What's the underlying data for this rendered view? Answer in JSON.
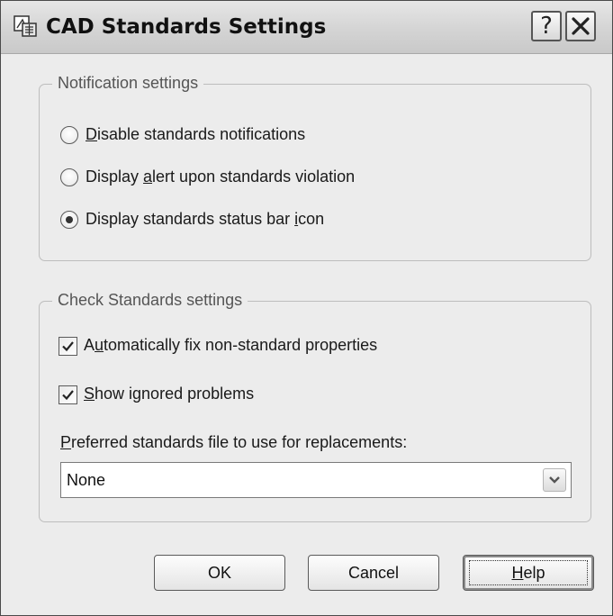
{
  "window": {
    "title": "CAD Standards Settings",
    "icons": {
      "app": "cad-standards-icon",
      "help": "help-icon",
      "close": "close-icon"
    },
    "help_glyph": "?"
  },
  "notification_group": {
    "legend": "Notification settings",
    "options": [
      {
        "pre": "",
        "key": "D",
        "post": "isable standards notifications",
        "selected": false
      },
      {
        "pre": "Display ",
        "key": "a",
        "post": "lert upon standards violation",
        "selected": false
      },
      {
        "pre": "Display standards status bar ",
        "key": "i",
        "post": "con",
        "selected": true
      }
    ]
  },
  "check_group": {
    "legend": "Check Standards settings",
    "auto_fix": {
      "pre": "A",
      "key": "u",
      "post": "tomatically fix non-standard properties",
      "checked": true
    },
    "show_ignored": {
      "pre": "",
      "key": "S",
      "post": "how ignored problems",
      "checked": true
    },
    "file_label": {
      "pre": "",
      "key": "P",
      "post": "referred standards file to use for replacements:"
    },
    "file_select": {
      "value": "None",
      "icon": "chevron-down-icon"
    }
  },
  "buttons": {
    "ok": "OK",
    "cancel": "Cancel",
    "help": {
      "pre": "",
      "key": "H",
      "post": "elp"
    }
  }
}
